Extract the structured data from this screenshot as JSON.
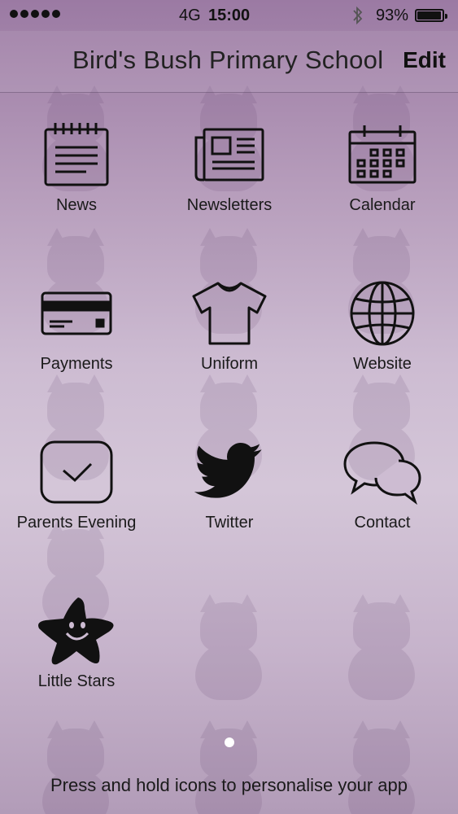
{
  "status": {
    "carrier": "4G",
    "time": "15:00",
    "battery_percent": "93%",
    "battery_level": 0.93
  },
  "navbar": {
    "title": "Bird's Bush Primary School",
    "edit_label": "Edit"
  },
  "tiles": [
    {
      "label": "News",
      "icon": "news-icon"
    },
    {
      "label": "Newsletters",
      "icon": "newspaper-icon"
    },
    {
      "label": "Calendar",
      "icon": "calendar-icon"
    },
    {
      "label": "Payments",
      "icon": "credit-card-icon"
    },
    {
      "label": "Uniform",
      "icon": "t-shirt-icon"
    },
    {
      "label": "Website",
      "icon": "globe-icon"
    },
    {
      "label": "Parents Evening",
      "icon": "checkbox-icon"
    },
    {
      "label": "Twitter",
      "icon": "twitter-bird-icon"
    },
    {
      "label": "Contact",
      "icon": "chat-bubbles-icon"
    },
    {
      "label": "Little Stars",
      "icon": "smiling-star-icon"
    }
  ],
  "pager": {
    "pages": 1,
    "current": 1
  },
  "footer": {
    "hint": "Press and hold icons to personalise your app"
  },
  "colors": {
    "background_top": "#9b7aa3",
    "background_mid": "#d4c6d8",
    "icon": "#111111"
  }
}
